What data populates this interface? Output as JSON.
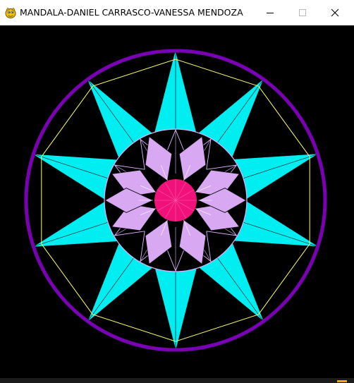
{
  "window": {
    "title": "MANDALA-DANIEL CARRASCO-VANESSA MENDOZA",
    "app_icon": "pygame-snake-icon",
    "controls": {
      "minimize_icon": "minimize-icon",
      "maximize_icon": "maximize-icon",
      "close_icon": "close-icon"
    }
  },
  "colors": {
    "background": "#000000",
    "outer_ring": "#7a00b4",
    "polygon_outline": "#ffff66",
    "star_points": "#00eef2",
    "inner_circle_outline": "#dcb4ff",
    "inner_petals": "#d9a8f2",
    "center_disc": "#f0127a",
    "segment_lines": "#dcb4ff",
    "taskbar_accent": "#f4a400"
  }
}
